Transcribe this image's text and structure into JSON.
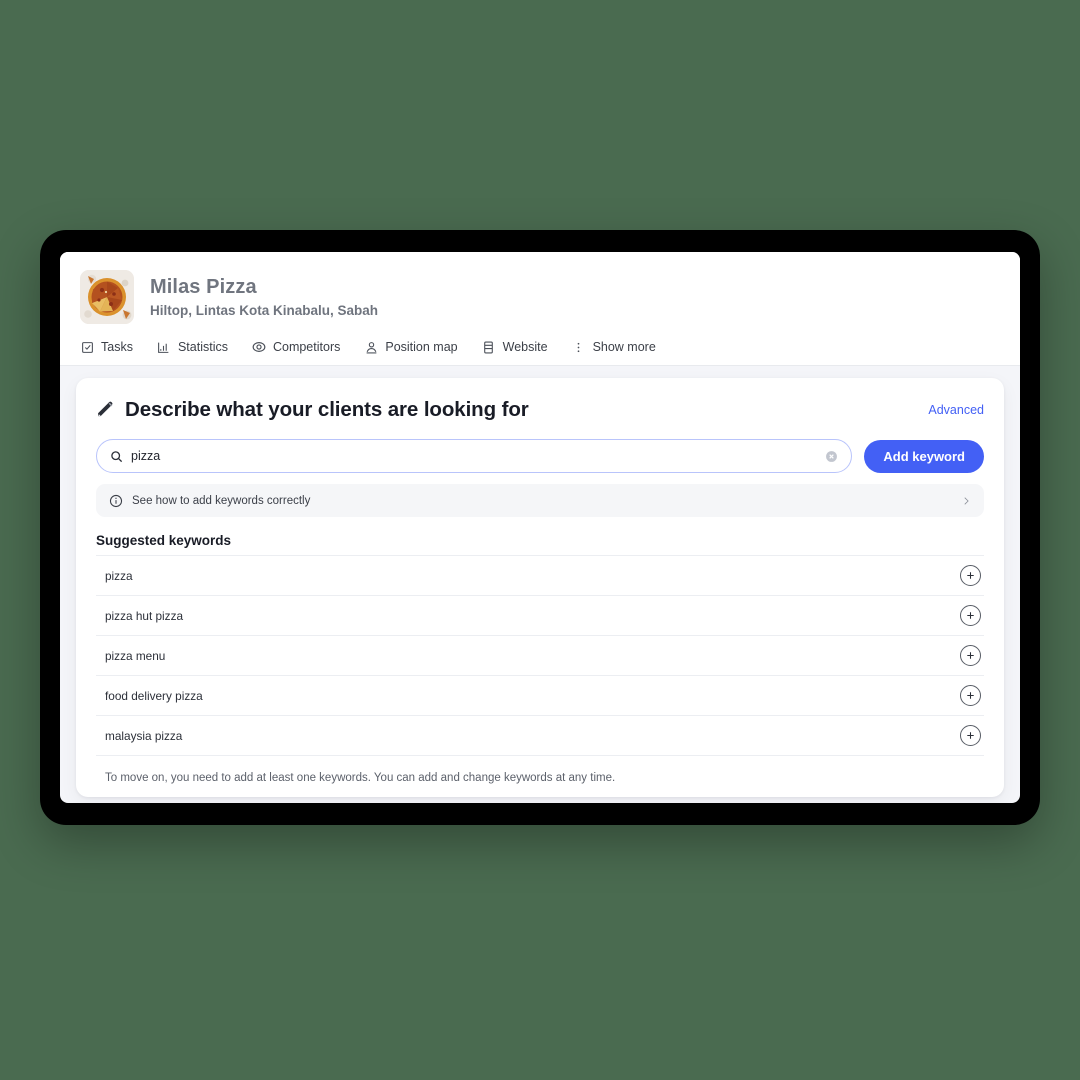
{
  "theme": {
    "page_background": "#4a6b50",
    "accent": "#4360f5",
    "frame": "#000000",
    "screen_background": "#f4f5f9"
  },
  "header": {
    "thumbnail_icon": "pizza-photo",
    "business_name": "Milas Pizza",
    "business_address": "Hiltop, Lintas Kota Kinabalu, Sabah",
    "tabs": [
      {
        "icon": "checkbox-icon",
        "label": "Tasks"
      },
      {
        "icon": "bar-chart-icon",
        "label": "Statistics"
      },
      {
        "icon": "eye-target-icon",
        "label": "Competitors"
      },
      {
        "icon": "person-pin-icon",
        "label": "Position map"
      },
      {
        "icon": "server-icon",
        "label": "Website"
      },
      {
        "icon": "dots-vertical-icon",
        "label": "Show more"
      }
    ]
  },
  "main": {
    "title": "Describe what your clients are looking for",
    "title_icon": "pencil-icon",
    "advanced_label": "Advanced",
    "search": {
      "icon": "search-icon",
      "value": "pizza",
      "placeholder": "Enter a keyword",
      "clear_icon": "clear-circle-icon"
    },
    "add_keyword_label": "Add keyword",
    "info_banner": {
      "icon": "info-icon",
      "text": "See how to add keywords correctly",
      "chevron_icon": "chevron-right-icon"
    },
    "suggested_title": "Suggested keywords",
    "suggested_keywords": [
      {
        "label": "pizza",
        "action_icon": "plus-icon"
      },
      {
        "label": "pizza hut pizza",
        "action_icon": "plus-icon"
      },
      {
        "label": "pizza menu",
        "action_icon": "plus-icon"
      },
      {
        "label": "food delivery pizza",
        "action_icon": "plus-icon"
      },
      {
        "label": "malaysia pizza",
        "action_icon": "plus-icon"
      }
    ],
    "footer_note": "To move on, you need to add at least one keywords. You can add and change keywords at any time."
  }
}
